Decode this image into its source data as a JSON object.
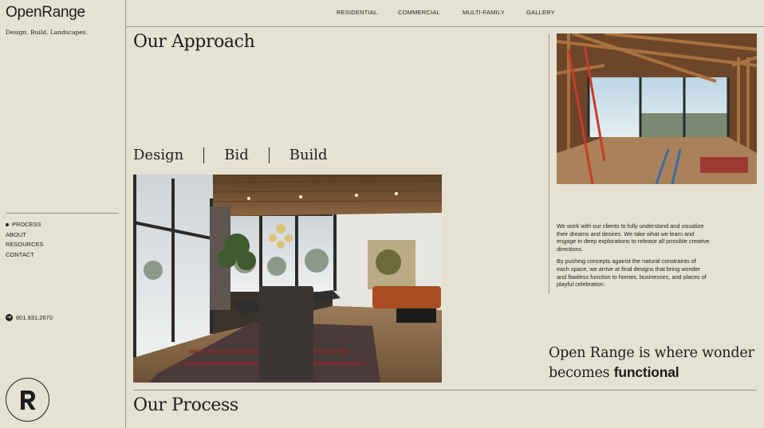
{
  "brand": {
    "name": "OpenRange",
    "tagline": "Design. Build. Landscapes."
  },
  "top_nav": [
    {
      "label": "RESIDENTIAL"
    },
    {
      "label": "COMMERCIAL"
    },
    {
      "label": "MULTI-FAMILY"
    },
    {
      "label": "GALLERY"
    }
  ],
  "side_nav": [
    {
      "label": "PROCESS",
      "active": true
    },
    {
      "label": "ABOUT"
    },
    {
      "label": "RESOURCES"
    },
    {
      "label": "CONTACT"
    }
  ],
  "phone": "801.931.2670",
  "badge_letter": "R",
  "main": {
    "section_title": "Our Approach",
    "steps": [
      "Design",
      "Bid",
      "Build"
    ],
    "paragraphs": [
      "We work with our clients to fully understand and visualize their dreams and desires. We take what we learn and engage in deep explorations to release all possible creative directions.",
      "By pushing concepts against the natural constraints of each space, we arrive at final designs that bring wonder and flawless function to homes, businesses, and places of playful celebration."
    ],
    "statement_line1": "Open Range is where wonder",
    "statement_line2_prefix": "becomes ",
    "statement_line2_bold": "functional",
    "next_section_title": "Our Process"
  },
  "colors": {
    "background": "#e5e2d4",
    "text": "#1d1d1b",
    "rule": "#9a9688"
  },
  "icons": {
    "active_marker": "dot-icon",
    "phone": "arrow-right-circle-icon",
    "badge": "r-monogram-icon"
  }
}
